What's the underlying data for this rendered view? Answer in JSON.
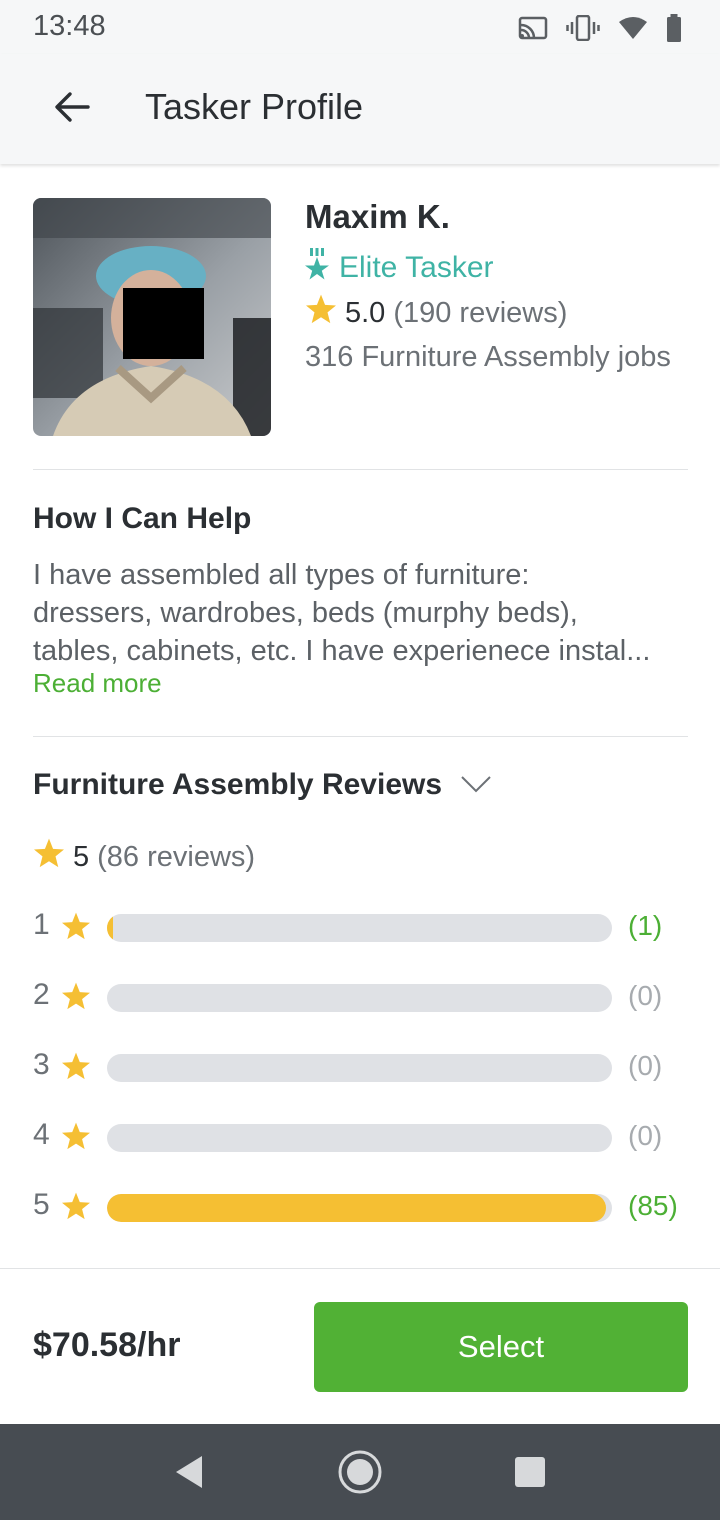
{
  "status_bar": {
    "time": "13:48"
  },
  "app_bar": {
    "title": "Tasker Profile"
  },
  "profile": {
    "name": "Maxim K.",
    "badge": "Elite Tasker",
    "rating_value": "5.0",
    "rating_count": "(190 reviews)",
    "jobs": "316 Furniture Assembly jobs"
  },
  "help": {
    "heading": "How I Can Help",
    "body_lines": [
      "I have assembled all types of furniture:",
      "dressers, wardrobes, beds (murphy beds),",
      "tables, cabinets, etc. I have experienece instal..."
    ],
    "read_more": "Read more"
  },
  "reviews": {
    "heading": "Furniture Assembly Reviews",
    "average": "5",
    "average_count": "(86 reviews)",
    "breakdown": [
      {
        "stars": "1",
        "count": "(1)",
        "fraction": 0.012
      },
      {
        "stars": "2",
        "count": "(0)",
        "fraction": 0
      },
      {
        "stars": "3",
        "count": "(0)",
        "fraction": 0
      },
      {
        "stars": "4",
        "count": "(0)",
        "fraction": 0
      },
      {
        "stars": "5",
        "count": "(85)",
        "fraction": 0.988
      }
    ]
  },
  "footer": {
    "price": "$70.58/hr",
    "select_label": "Select"
  },
  "colors": {
    "accent_green": "#51b135",
    "elite_teal": "#3fb3a5",
    "star_yellow": "#f5bf33"
  }
}
